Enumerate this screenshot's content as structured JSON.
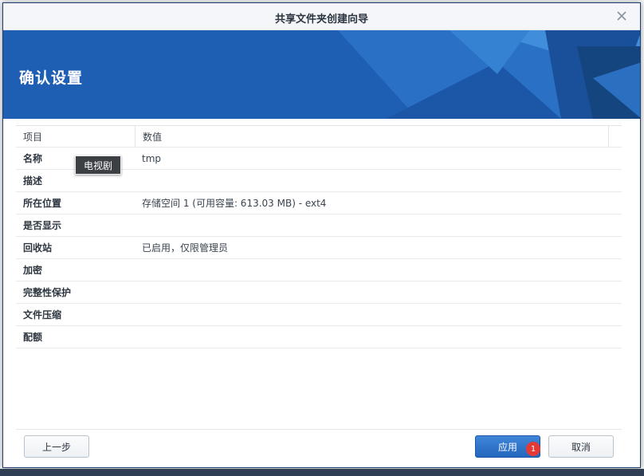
{
  "dialog": {
    "title": "共享文件夹创建向导",
    "heading": "确认设置"
  },
  "table": {
    "headers": [
      "项目",
      "数值"
    ],
    "rows": [
      {
        "item": "名称",
        "value": "tmp"
      },
      {
        "item": "描述",
        "value": ""
      },
      {
        "item": "所在位置",
        "value": "存储空间 1 (可用容量:  613.03 MB) - ext4"
      },
      {
        "item": "是否显示",
        "value": ""
      },
      {
        "item": "回收站",
        "value": "已启用，仅限管理员"
      },
      {
        "item": "加密",
        "value": ""
      },
      {
        "item": "完整性保护",
        "value": ""
      },
      {
        "item": "文件压缩",
        "value": ""
      },
      {
        "item": "配额",
        "value": ""
      }
    ]
  },
  "tooltip": "电视剧",
  "footer": {
    "prev_label": "上一步",
    "apply_label": "应用",
    "cancel_label": "取消",
    "badge": "1"
  },
  "icons": {
    "close": "close-icon"
  },
  "colors": {
    "banner": "#1f62b6",
    "primary_button": "#2466be",
    "badge": "#e53935"
  }
}
